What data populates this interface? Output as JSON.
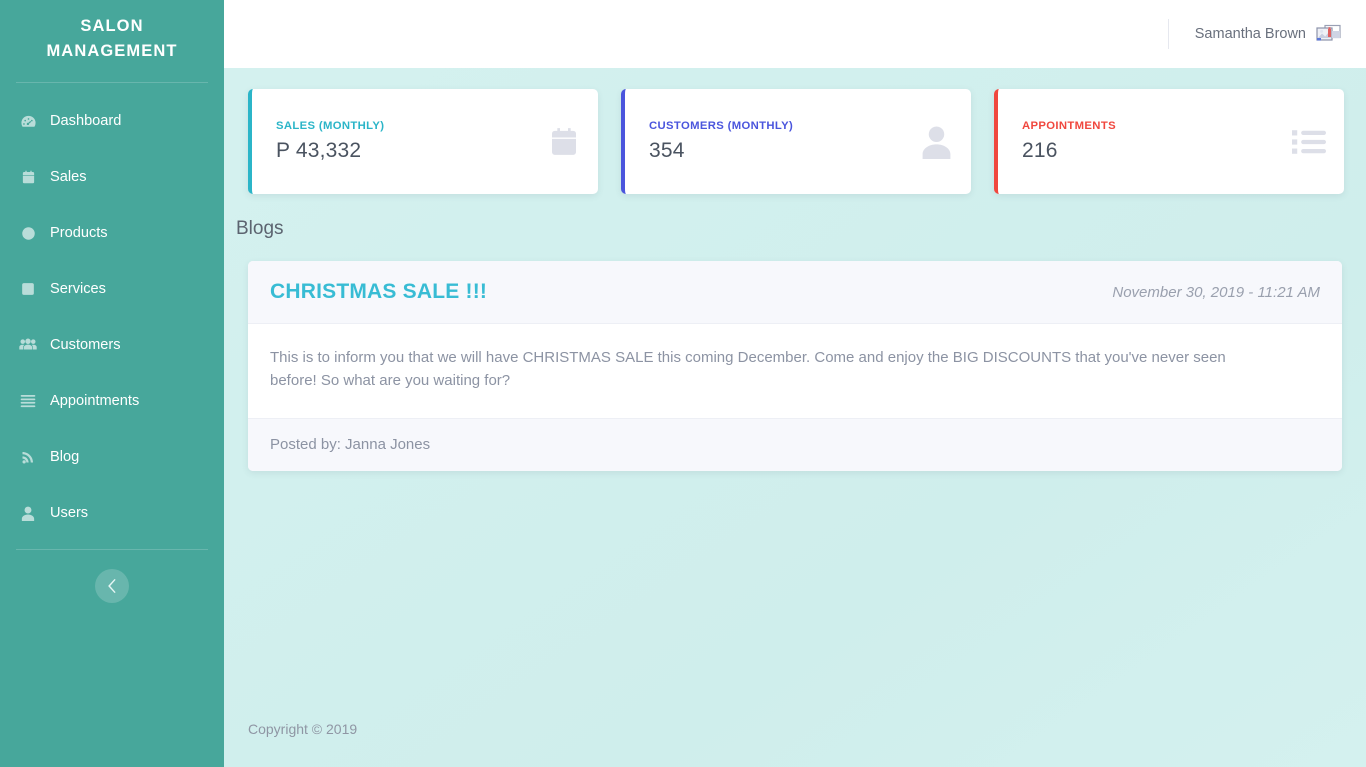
{
  "sidebar": {
    "brand": "SALON MANAGEMENT",
    "items": [
      {
        "label": "Dashboard",
        "icon": "tachometer-icon"
      },
      {
        "label": "Sales",
        "icon": "calendar-icon"
      },
      {
        "label": "Products",
        "icon": "circle-icon"
      },
      {
        "label": "Services",
        "icon": "square-icon"
      },
      {
        "label": "Customers",
        "icon": "users-icon"
      },
      {
        "label": "Appointments",
        "icon": "list-icon"
      },
      {
        "label": "Blog",
        "icon": "rss-icon"
      },
      {
        "label": "Users",
        "icon": "user-icon"
      }
    ],
    "toggle_icon": "chevron-left-icon",
    "background_color": "#47a79b"
  },
  "header": {
    "user_name": "Samantha Brown",
    "avatar_icon": "broken-image-icon"
  },
  "stats": [
    {
      "label": "SALES (MONTHLY)",
      "value": "P 43,332",
      "accent": "#2bb5c8",
      "icon": "calendar-icon"
    },
    {
      "label": "CUSTOMERS (MONTHLY)",
      "value": "354",
      "accent": "#4a55dd",
      "icon": "user-icon"
    },
    {
      "label": "APPOINTMENTS",
      "value": "216",
      "accent": "#f0473e",
      "icon": "list-icon"
    }
  ],
  "main": {
    "section_title": "Blogs",
    "blog": {
      "title": "CHRISTMAS SALE !!!",
      "date": "November 30, 2019 - 11:21 AM",
      "body": "This is to inform you that we will have CHRISTMAS SALE this coming December. Come and enjoy the BIG DISCOUNTS that you've never seen before! So what are you waiting for?",
      "posted_by": "Posted by: Janna Jones"
    }
  },
  "footer": {
    "copyright": "Copyright © 2019"
  }
}
